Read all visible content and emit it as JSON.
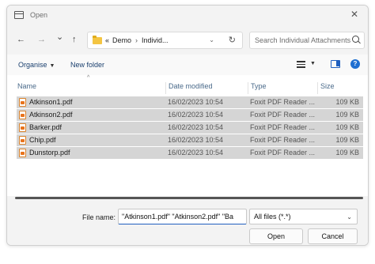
{
  "window": {
    "title": "Open",
    "close_glyph": "✕"
  },
  "nav": {
    "back_glyph": "←",
    "forward_glyph": "→",
    "recent_glyph": "⌄",
    "up_glyph": "↑",
    "address": {
      "overflow": "«",
      "crumb1": "Demo",
      "sep": "›",
      "crumb2": "Individ...",
      "dropdown_glyph": "⌄",
      "refresh_glyph": "↻"
    },
    "search_placeholder": "Search Individual Attachments"
  },
  "toolbar": {
    "organise": "Organise",
    "new_folder": "New folder",
    "caret": "▼"
  },
  "columns": {
    "name": "Name",
    "date_modified": "Date modified",
    "type": "Type",
    "size": "Size",
    "sort_glyph": "^"
  },
  "files": [
    {
      "name": "Atkinson1.pdf",
      "date": "16/02/2023 10:54",
      "type": "Foxit PDF Reader ...",
      "size": "109 KB"
    },
    {
      "name": "Atkinson2.pdf",
      "date": "16/02/2023 10:54",
      "type": "Foxit PDF Reader ...",
      "size": "109 KB"
    },
    {
      "name": "Barker.pdf",
      "date": "16/02/2023 10:54",
      "type": "Foxit PDF Reader ...",
      "size": "109 KB"
    },
    {
      "name": "Chip.pdf",
      "date": "16/02/2023 10:54",
      "type": "Foxit PDF Reader ...",
      "size": "109 KB"
    },
    {
      "name": "Dunstorp.pdf",
      "date": "16/02/2023 10:54",
      "type": "Foxit PDF Reader ...",
      "size": "109 KB"
    }
  ],
  "footer": {
    "file_name_label": "File name:",
    "file_name_value": "\"Atkinson1.pdf\" \"Atkinson2.pdf\" \"Ba",
    "file_type": "All files (*.*)",
    "open": "Open",
    "cancel": "Cancel"
  },
  "colors": {
    "selection": "#d5d5d5",
    "accent": "#1f5fbf",
    "help": "#1f6fd1"
  },
  "icons": {
    "title": "window-icon",
    "folder": "folder-icon",
    "search": "search-icon",
    "view": "view-options-icon",
    "pane": "preview-pane-icon",
    "help": "help-icon",
    "file": "pdf-file-icon"
  }
}
